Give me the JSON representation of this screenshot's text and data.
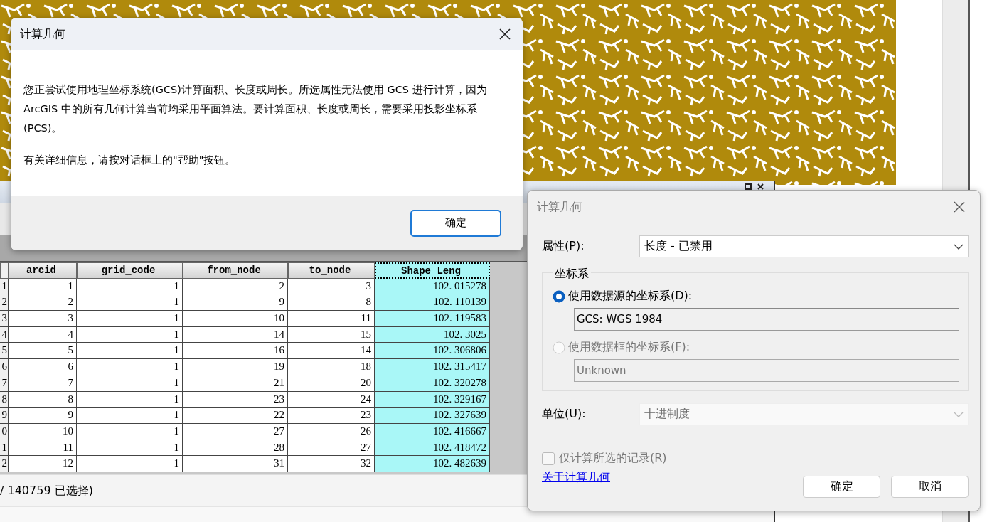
{
  "table_window": {
    "columns": [
      {
        "label": "arcid",
        "selected": false
      },
      {
        "label": "grid_code",
        "selected": false
      },
      {
        "label": "from_node",
        "selected": false
      },
      {
        "label": "to_node",
        "selected": false
      },
      {
        "label": "Shape_Leng",
        "selected": true
      }
    ],
    "rows": [
      {
        "row_number": "1",
        "cells": [
          "1",
          "1",
          "2",
          "3",
          "102. 015278"
        ]
      },
      {
        "row_number": "2",
        "cells": [
          "2",
          "1",
          "9",
          "8",
          "102. 110139"
        ]
      },
      {
        "row_number": "3",
        "cells": [
          "3",
          "1",
          "10",
          "11",
          "102. 119583"
        ]
      },
      {
        "row_number": "4",
        "cells": [
          "4",
          "1",
          "14",
          "15",
          "102. 3025"
        ]
      },
      {
        "row_number": "5",
        "cells": [
          "5",
          "1",
          "16",
          "14",
          "102. 306806"
        ]
      },
      {
        "row_number": "6",
        "cells": [
          "6",
          "1",
          "19",
          "18",
          "102. 315417"
        ]
      },
      {
        "row_number": "7",
        "cells": [
          "7",
          "1",
          "21",
          "20",
          "102. 320278"
        ]
      },
      {
        "row_number": "8",
        "cells": [
          "8",
          "1",
          "23",
          "24",
          "102. 329167"
        ]
      },
      {
        "row_number": "9",
        "cells": [
          "9",
          "1",
          "22",
          "23",
          "102. 327639"
        ]
      },
      {
        "row_number": "0",
        "cells": [
          "10",
          "1",
          "27",
          "26",
          "102. 416667"
        ]
      },
      {
        "row_number": "1",
        "cells": [
          "11",
          "1",
          "28",
          "27",
          "102. 418472"
        ]
      },
      {
        "row_number": "2",
        "cells": [
          "12",
          "1",
          "31",
          "32",
          "102. 482639"
        ]
      }
    ],
    "status": "/ 140759 已选择)"
  },
  "message_dialog": {
    "title": "计算几何",
    "paragraphs": [
      "您正尝试使用地理坐标系统(GCS)计算面积、长度或周长。所选属性无法使用 GCS 进行计算，因为 ArcGIS 中的所有几何计算当前均采用平面算法。要计算面积、长度或周长，需要采用投影坐标系(PCS)。",
      "有关详细信息，请按对话框上的\"帮助\"按钮。"
    ],
    "buttons": [
      {
        "label": "确定",
        "default": true
      }
    ]
  },
  "geometry_dialog": {
    "title": "计算几何",
    "active": false,
    "property": {
      "label": "属性(P):",
      "value": "长度 - 已禁用"
    },
    "coordinate_group": {
      "title": "坐标系",
      "options": [
        {
          "label": "使用数据源的坐标系(D):",
          "selected": true,
          "disabled": false,
          "value": "GCS: WGS 1984"
        },
        {
          "label": "使用数据框的坐标系(F):",
          "selected": false,
          "disabled": true,
          "value": "Unknown"
        }
      ]
    },
    "unit": {
      "label": "单位(U):",
      "value": "十进制度",
      "disabled": true
    },
    "selected_only": {
      "label": "仅计算所选的记录(R)",
      "checked": false,
      "disabled": true
    },
    "help_link": "关于计算几何",
    "buttons": [
      {
        "label": "确定"
      },
      {
        "label": "取消"
      }
    ]
  }
}
